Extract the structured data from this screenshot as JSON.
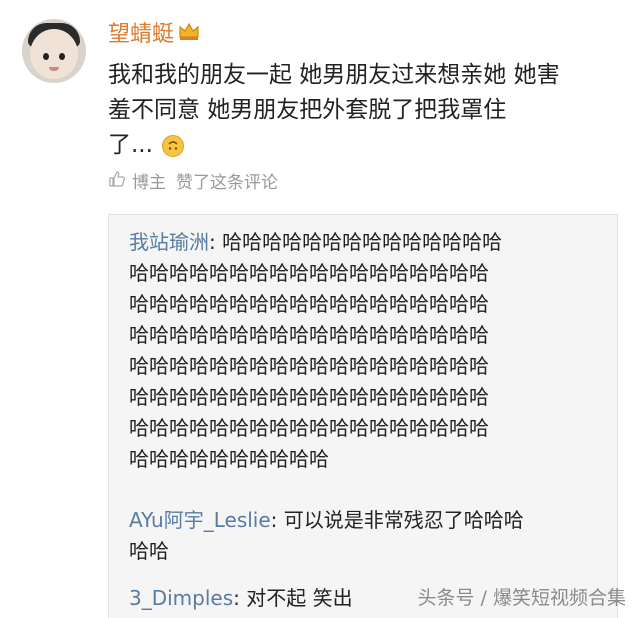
{
  "post": {
    "username": "望蜻蜓",
    "comment_lines": [
      "我和我的朋友一起 她男朋友过来想亲她 她害",
      "羞不同意 她男朋友把外套脱了把我罩住",
      "了..."
    ],
    "emoji": "upside-down-face-icon",
    "like_author": "博主",
    "like_text": "赞了这条评论"
  },
  "replies": [
    {
      "name": "我站瑜洲",
      "lines": [
        "哈哈哈哈哈哈哈哈哈哈哈哈哈哈",
        "哈哈哈哈哈哈哈哈哈哈哈哈哈哈哈哈哈哈",
        "哈哈哈哈哈哈哈哈哈哈哈哈哈哈哈哈哈哈",
        "哈哈哈哈哈哈哈哈哈哈哈哈哈哈哈哈哈哈",
        "哈哈哈哈哈哈哈哈哈哈哈哈哈哈哈哈哈哈",
        "哈哈哈哈哈哈哈哈哈哈哈哈哈哈哈哈哈哈",
        "哈哈哈哈哈哈哈哈哈哈哈哈哈哈哈哈哈哈",
        "哈哈哈哈哈哈哈哈哈哈"
      ]
    },
    {
      "name": "AYu阿宇_Leslie",
      "lines": [
        "可以说是非常残忍了哈哈哈",
        "哈哈"
      ]
    },
    {
      "name": "3_Dimples",
      "lines": [
        "对不起 笑出"
      ]
    }
  ],
  "watermark": "头条号 / 爆笑短视频合集",
  "colors": {
    "username": "#e07a2c",
    "reply_name": "#587ca2",
    "muted": "#999999",
    "reply_bg": "#f5f5f5"
  }
}
